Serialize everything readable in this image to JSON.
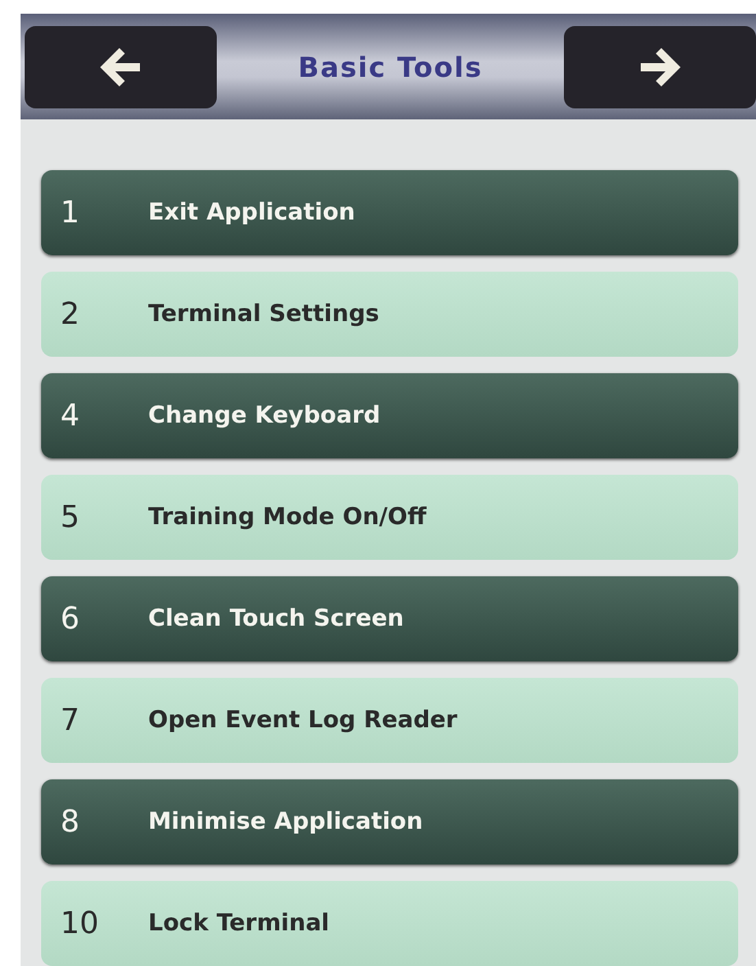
{
  "header": {
    "title": "Basic Tools"
  },
  "menu": [
    {
      "number": "1",
      "label": "Exit Application",
      "kind": "dark"
    },
    {
      "number": "2",
      "label": "Terminal Settings",
      "kind": "light"
    },
    {
      "number": "4",
      "label": "Change Keyboard",
      "kind": "dark"
    },
    {
      "number": "5",
      "label": "Training Mode On/Off",
      "kind": "light"
    },
    {
      "number": "6",
      "label": "Clean Touch Screen",
      "kind": "dark"
    },
    {
      "number": "7",
      "label": "Open Event Log Reader",
      "kind": "light"
    },
    {
      "number": "8",
      "label": "Minimise Application",
      "kind": "dark"
    },
    {
      "number": "10",
      "label": "Lock Terminal",
      "kind": "light"
    }
  ]
}
